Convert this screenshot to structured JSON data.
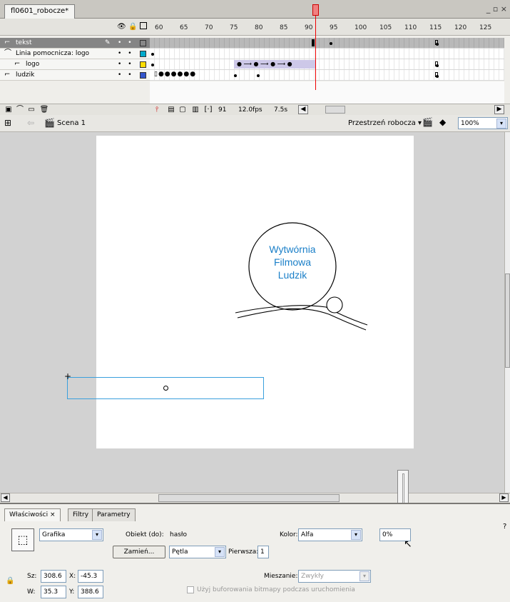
{
  "document": {
    "tab_title": "fl0601_robocze*",
    "window_controls": "_ ▫ ×"
  },
  "timeline": {
    "ruler": [
      "60",
      "65",
      "70",
      "75",
      "80",
      "85",
      "90",
      "95",
      "100",
      "105",
      "110",
      "115",
      "120",
      "125"
    ],
    "layers": [
      {
        "name": "tekst",
        "icon": "layer-icon",
        "selected": true
      },
      {
        "name": "Linia pomocnicza: logo",
        "icon": "guide-layer-icon",
        "selected": false
      },
      {
        "name": "logo",
        "icon": "layer-icon",
        "selected": false
      },
      {
        "name": "ludzik",
        "icon": "layer-icon",
        "selected": false
      }
    ],
    "layer_colors": [
      "#888888",
      "#00aacc",
      "#ffdd00",
      "#3355cc"
    ],
    "current_frame": "91",
    "fps": "12.0fps",
    "elapsed": "7.5s"
  },
  "editbar": {
    "scene": "Scena 1",
    "workspace": "Przestrzeń robocza ▾",
    "zoom": "100%"
  },
  "stage": {
    "logo_lines": [
      "Wytwórnia",
      "Filmowa",
      "Ludzik"
    ],
    "logo_color": "#1a7fc8"
  },
  "properties": {
    "tabs": [
      "Właściwości ×",
      "Filtry",
      "Parametry"
    ],
    "symbol_type": "Grafika",
    "instance_label": "Obiekt (do):",
    "instance_name": "hasło",
    "swap_label": "Zamień...",
    "loop_value": "Pętla",
    "first_label": "Pierwsza:",
    "first_value": "1",
    "color_label": "Kolor:",
    "color_value": "Alfa",
    "alpha_value": "0%",
    "blend_label": "Mieszanie:",
    "blend_value": "Zwykły",
    "cache_label": "Użyj buforowania bitmapy podczas uruchomienia",
    "sz_label": "Sz:",
    "sz_value": "308.6",
    "x_label": "X:",
    "x_value": "-45.3",
    "w_label": "W:",
    "w_value": "35.3",
    "y_label": "Y:",
    "y_value": "388.6"
  }
}
